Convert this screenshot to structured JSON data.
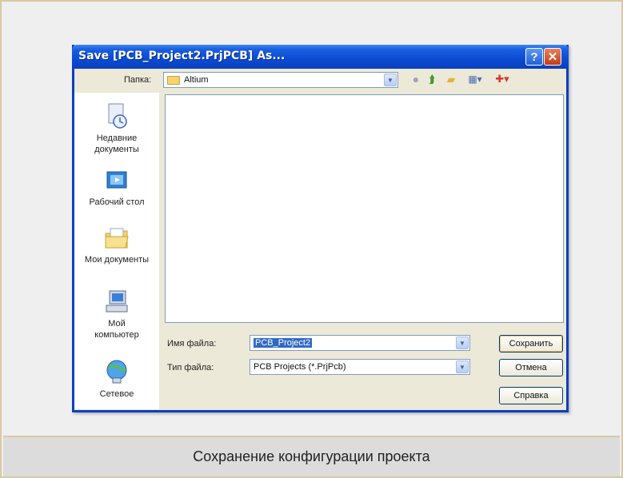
{
  "dialog": {
    "title": "Save [PCB_Project2.PrjPCB] As...",
    "help_label": "?",
    "close_label": "✕"
  },
  "folder": {
    "label": "Папка:",
    "value": "Altium"
  },
  "places": [
    {
      "label": "Недавние документы",
      "icon": "recent-documents-icon"
    },
    {
      "label": "Рабочий стол",
      "icon": "desktop-icon"
    },
    {
      "label": "Мои документы",
      "icon": "my-documents-icon"
    },
    {
      "label": "Мой компьютер",
      "icon": "my-computer-icon"
    },
    {
      "label": "Сетевое",
      "icon": "network-icon"
    }
  ],
  "filename": {
    "label": "Имя файла:",
    "value": "PCB_Project2"
  },
  "filetype": {
    "label": "Тип файла:",
    "value": "PCB Projects (*.PrjPcb)"
  },
  "buttons": {
    "save": "Сохранить",
    "cancel": "Отмена",
    "help": "Справка"
  },
  "caption": "Сохранение конфигурации проекта",
  "colors": {
    "titlebar": "#0b4cd2",
    "dialog_bg": "#ece9d8",
    "frame_border": "#d9c9a3",
    "selection": "#316ac5"
  }
}
